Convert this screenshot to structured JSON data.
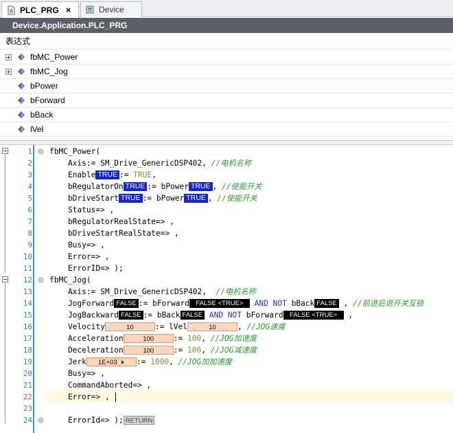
{
  "tabs": [
    {
      "label": "PLC_PRG",
      "close": "×"
    },
    {
      "label": "Device"
    }
  ],
  "title": "Device.Application.PLC_PRG",
  "declaration": {
    "header": "表达式",
    "variables": [
      {
        "name": "fbMC_Power",
        "expandable": true
      },
      {
        "name": "fbMC_Jog",
        "expandable": true
      },
      {
        "name": "bPower",
        "expandable": false
      },
      {
        "name": "bForward",
        "expandable": false
      },
      {
        "name": "bBack",
        "expandable": false
      },
      {
        "name": "lVel",
        "expandable": false
      }
    ]
  },
  "code": {
    "line_numbers": [
      "1",
      "2",
      "3",
      "4",
      "5",
      "6",
      "7",
      "8",
      "9",
      "10",
      "11",
      "12",
      "13",
      "14",
      "15",
      "16",
      "17",
      "18",
      "19",
      "20",
      "21",
      "22",
      "23",
      "24"
    ],
    "current_line": 22,
    "l1": "fbMC_Power(",
    "l2a": "    Axis:= SM_Drive_GenericDSP402, ",
    "l2c": "//电机名称",
    "l3a": "    Enable",
    "l3m": "TRUE",
    "l3b": ":= ",
    "l3l": "TRUE",
    "l3c": ",",
    "l4a": "    bRegulatorOn",
    "l4m": "TRUE",
    "l4b": ":= bPower",
    "l4m2": "TRUE",
    "l4d": ", ",
    "l4c": "//使能开关",
    "l5a": "    bDriveStart",
    "l5m": "TRUE",
    "l5b": ":= bPower",
    "l5m2": "TRUE",
    "l5d": ", ",
    "l5c": "//使能开关",
    "l6": "    Status=> ,",
    "l7": "    bRegulatorRealState=> ,",
    "l8": "    bDriveStartRealState=> ,",
    "l9": "    Busy=> ,",
    "l10": "    Error=> ,",
    "l11": "    ErrorID=> );",
    "l12": "fbMC_Jog(",
    "l13a": "    Axis:= SM_Drive_GenericDSP402,  ",
    "l13c": "//电机名称",
    "l14a": "    JogForward",
    "l14m": "FALSE",
    "l14b": ":= bForward",
    "l14m2": "FALSE <TRUE>",
    "l14k1": "AND NOT",
    "l14e": " bBack",
    "l14m3": "FALSE",
    "l14d": " , ",
    "l14c": "//前进后退开关互锁",
    "l15a": "    JogBackward",
    "l15m": "FALSE",
    "l15b": ":= bBack",
    "l15m2": "FALSE",
    "l15k1": "AND NOT",
    "l15e": " bForward",
    "l15m3": "FALSE <TRUE>",
    "l15d": " ,",
    "l16a": "    Velocity",
    "l16m": "10",
    "l16b": ":= lVel",
    "l16m2": "10",
    "l16d": ", ",
    "l16c": "//JOG速度",
    "l17a": "    Acceleration",
    "l17m": "100",
    "l17b": ":= ",
    "l17l": "100",
    "l17d": ", ",
    "l17c": "//JOG加速度",
    "l18a": "    Deceleration",
    "l18m": "100",
    "l18b": ":= ",
    "l18l": "100",
    "l18d": ", ",
    "l18c": "//JOG减速度",
    "l19a": "    Jerk",
    "l19m": "1E+03",
    "l19b": ":= ",
    "l19l": "1000",
    "l19d": ", ",
    "l19c": "//JOG加加速度",
    "l20": "    Busy=> ,",
    "l21": "    CommandAborted=> ,",
    "l22": "    Error=> , ",
    "l23": "",
    "l24a": "    ErrorId=> );",
    "l24m": "RETURN"
  },
  "colors": {
    "title_bg": "#5b5f66",
    "monitor_true": "#1124d8",
    "monitor_false": "#000000",
    "monitor_value": "#fcd7bf",
    "comment": "#2c9a31",
    "line_number": "#2f86b8",
    "gutter": "#2e9bc8"
  }
}
